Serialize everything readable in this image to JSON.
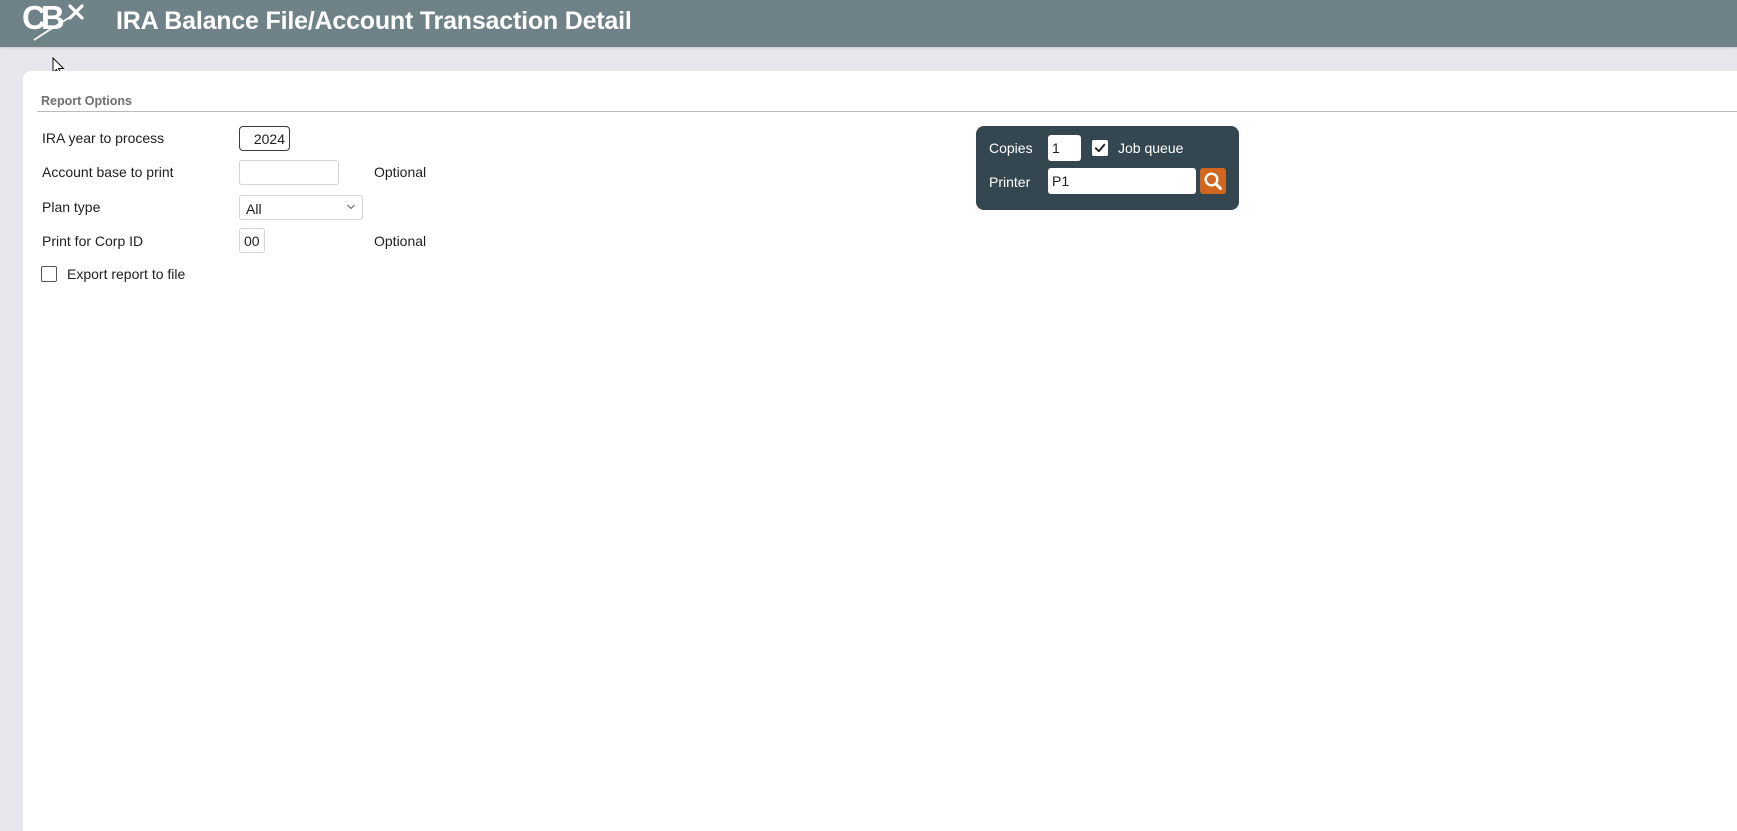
{
  "header": {
    "title": "IRA Balance File/Account Transaction Detail",
    "logo_text": "CBX"
  },
  "report_options": {
    "section_title": "Report Options",
    "ira_year": {
      "label": "IRA year to process",
      "value": "2024"
    },
    "account_base": {
      "label": "Account base to print",
      "value": "",
      "note": "Optional"
    },
    "plan_type": {
      "label": "Plan type",
      "selected": "All"
    },
    "corp_id": {
      "label": "Print for Corp ID",
      "value": "00",
      "note": "Optional"
    },
    "export": {
      "label": "Export report to file",
      "checked": false
    }
  },
  "print_settings": {
    "copies_label": "Copies",
    "copies_value": "1",
    "job_queue_label": "Job queue",
    "job_queue_checked": true,
    "printer_label": "Printer",
    "printer_value": "P1"
  },
  "colors": {
    "header_bg": "#6f8287",
    "print_box_bg": "#344650",
    "search_button": "#d1661e"
  }
}
